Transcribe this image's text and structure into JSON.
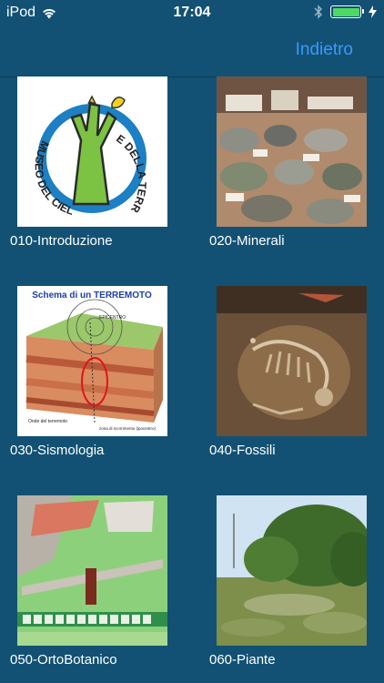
{
  "status_bar": {
    "carrier": "iPod",
    "time": "17:04",
    "battery_percent": 100,
    "battery_color": "#4cd964"
  },
  "nav": {
    "back_label": "Indietro",
    "accent_color": "#3a99ff"
  },
  "background_color": "#125173",
  "items": [
    {
      "label": "010-Introduzione",
      "image": "museum-logo",
      "logo_text": "MUSEO DEL CIELO E DELLA TERRA"
    },
    {
      "label": "020-Minerali",
      "image": "minerals-photo"
    },
    {
      "label": "030-Sismologia",
      "image": "earthquake-diagram",
      "diagram_title": "Schema di un TERREMOTO",
      "diagram_labels": [
        "EPICENTRO",
        "Onde del terremoto",
        "zona di scorrimento (ipocentro)"
      ]
    },
    {
      "label": "040-Fossili",
      "image": "fossil-photo"
    },
    {
      "label": "050-OrtoBotanico",
      "image": "garden-map"
    },
    {
      "label": "060-Piante",
      "image": "plants-photo"
    }
  ]
}
